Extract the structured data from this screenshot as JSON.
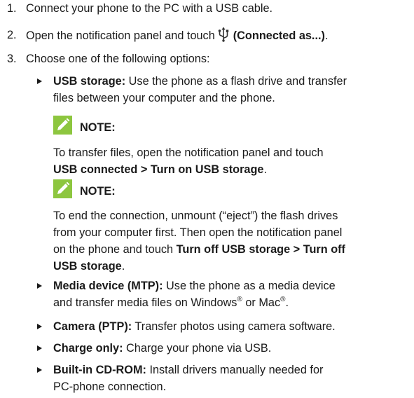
{
  "steps": [
    {
      "num": "1.",
      "text": "Connect your phone to the PC with a USB cable."
    },
    {
      "num": "2.",
      "text": "Open the notification panel and touch",
      "icon": "usb-icon",
      "bold": "(Connected as...)",
      "tail": "."
    },
    {
      "num": "3.",
      "text": "Choose one of the following options:"
    }
  ],
  "options": [
    {
      "title": "USB storage:",
      "line1": " Use the phone as a flash drive and transfer",
      "line2": "files between your computer and the phone."
    },
    {
      "title": "Media device (MTP):",
      "line1": " Use the phone as a media device",
      "line2a": "and transfer media files on Windows",
      "reg1": "®",
      "line2b": " or Mac",
      "reg2": "®",
      "line2c": "."
    },
    {
      "title": "Camera (PTP):",
      "line1": " Transfer photos using camera software."
    },
    {
      "title": "Charge only:",
      "line1": " Charge your phone via USB."
    },
    {
      "title": "Built-in CD-ROM:",
      "line1": " Install drivers manually needed for",
      "line2": "PC-phone connection."
    }
  ],
  "notes": [
    {
      "label": "NOTE:",
      "icon": "pencil-icon",
      "l1": "To transfer files, open the notification panel and touch",
      "l2_bold": "USB connected > Turn on USB storage",
      "l2_tail": "."
    },
    {
      "label": "NOTE:",
      "icon": "pencil-icon",
      "l1": "To end the connection, unmount (“eject”) the flash drives",
      "l2": "from your computer first. Then open the notification panel",
      "l3": "on the phone and touch ",
      "l3_bold": "Turn off USB storage > Turn off",
      "l4_bold": "USB storage",
      "l4_tail": "."
    }
  ],
  "colors": {
    "note_icon": "#8dc63f",
    "text": "#1a1a1a"
  }
}
